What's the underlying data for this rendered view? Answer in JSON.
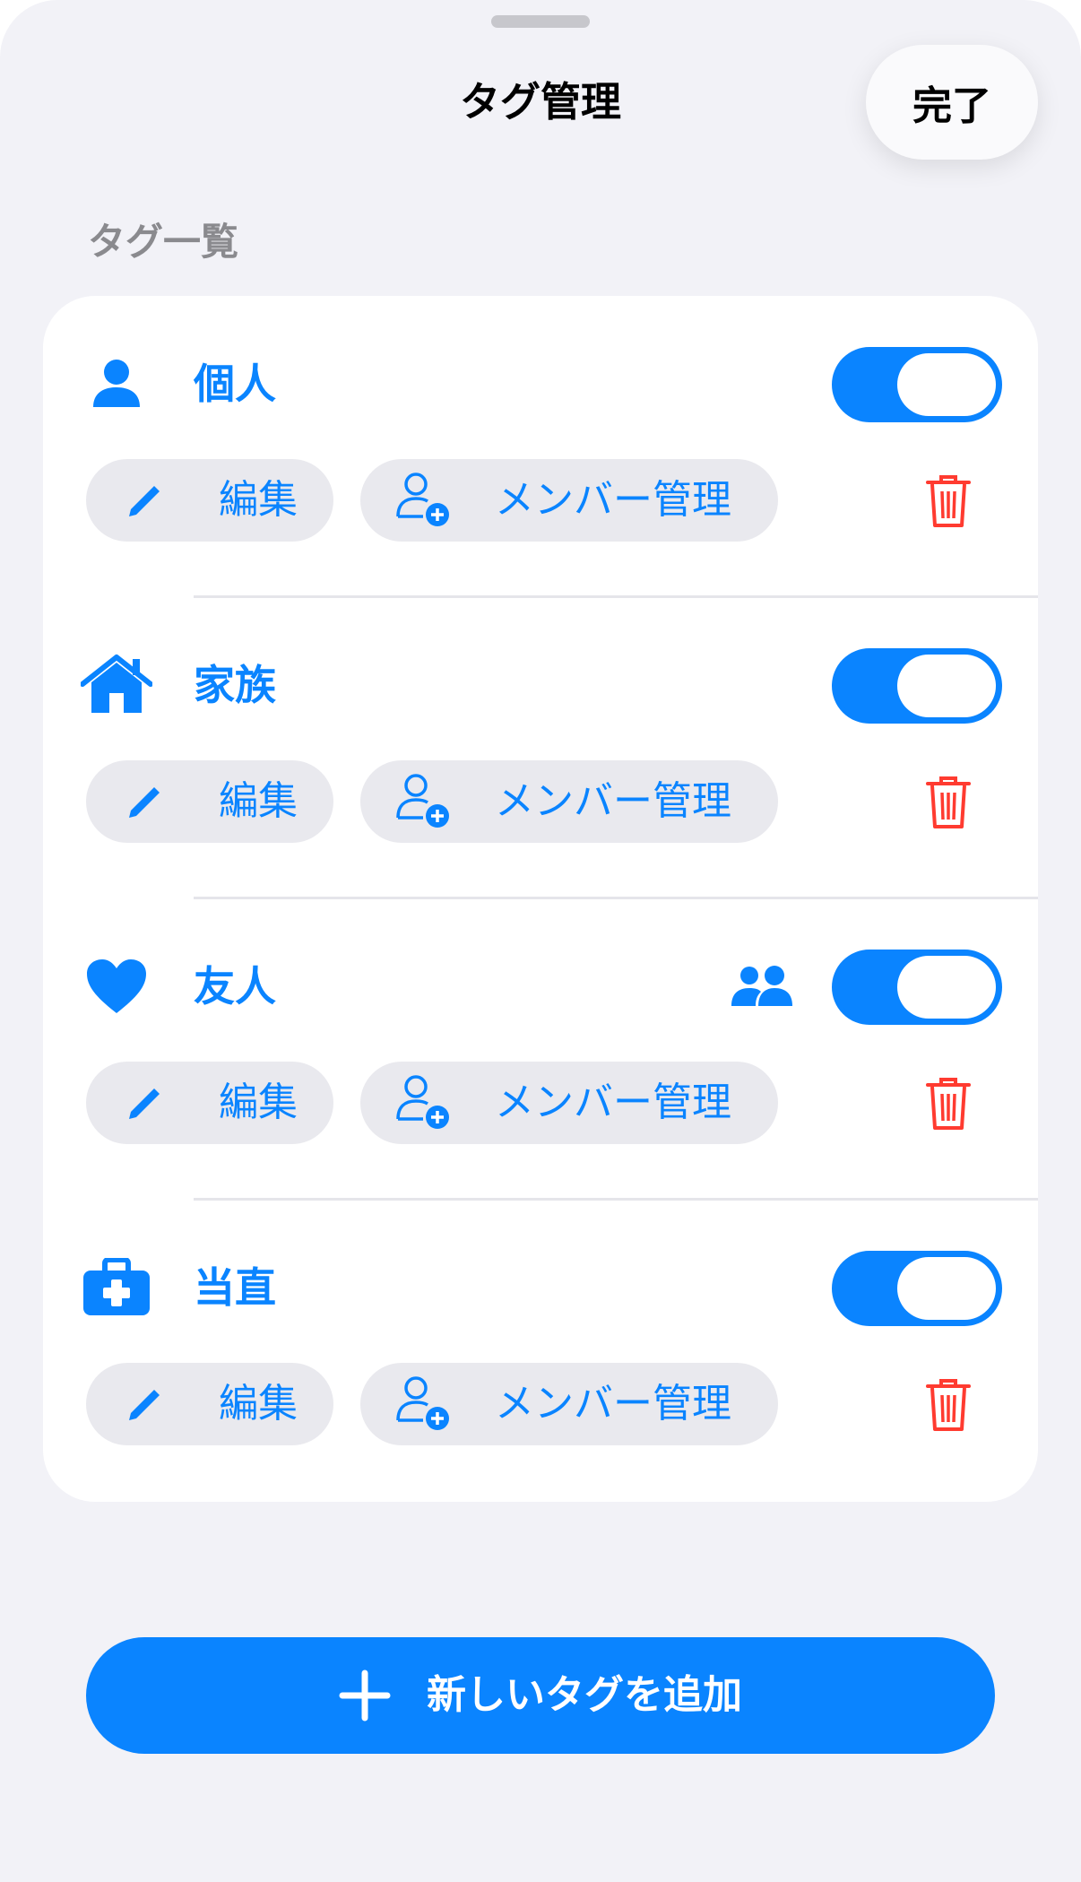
{
  "nav": {
    "title": "タグ管理",
    "done_label": "完了"
  },
  "section": {
    "header": "タグ一覧"
  },
  "tags": [
    {
      "name": "個人",
      "icon": "person-fill-icon",
      "enabled": true,
      "shared": false,
      "edit_label": "編集",
      "members_label": "メンバー管理"
    },
    {
      "name": "家族",
      "icon": "house-fill-icon",
      "enabled": true,
      "shared": false,
      "edit_label": "編集",
      "members_label": "メンバー管理"
    },
    {
      "name": "友人",
      "icon": "heart-fill-icon",
      "enabled": true,
      "shared": true,
      "edit_label": "編集",
      "members_label": "メンバー管理"
    },
    {
      "name": "当直",
      "icon": "medical-bag-icon",
      "enabled": true,
      "shared": false,
      "edit_label": "編集",
      "members_label": "メンバー管理"
    }
  ],
  "add_button": {
    "label": "新しいタグを追加"
  },
  "colors": {
    "accent": "#0a84ff",
    "destructive": "#ff3b30",
    "background": "#f2f2f7",
    "pill": "#e9e9ee"
  }
}
